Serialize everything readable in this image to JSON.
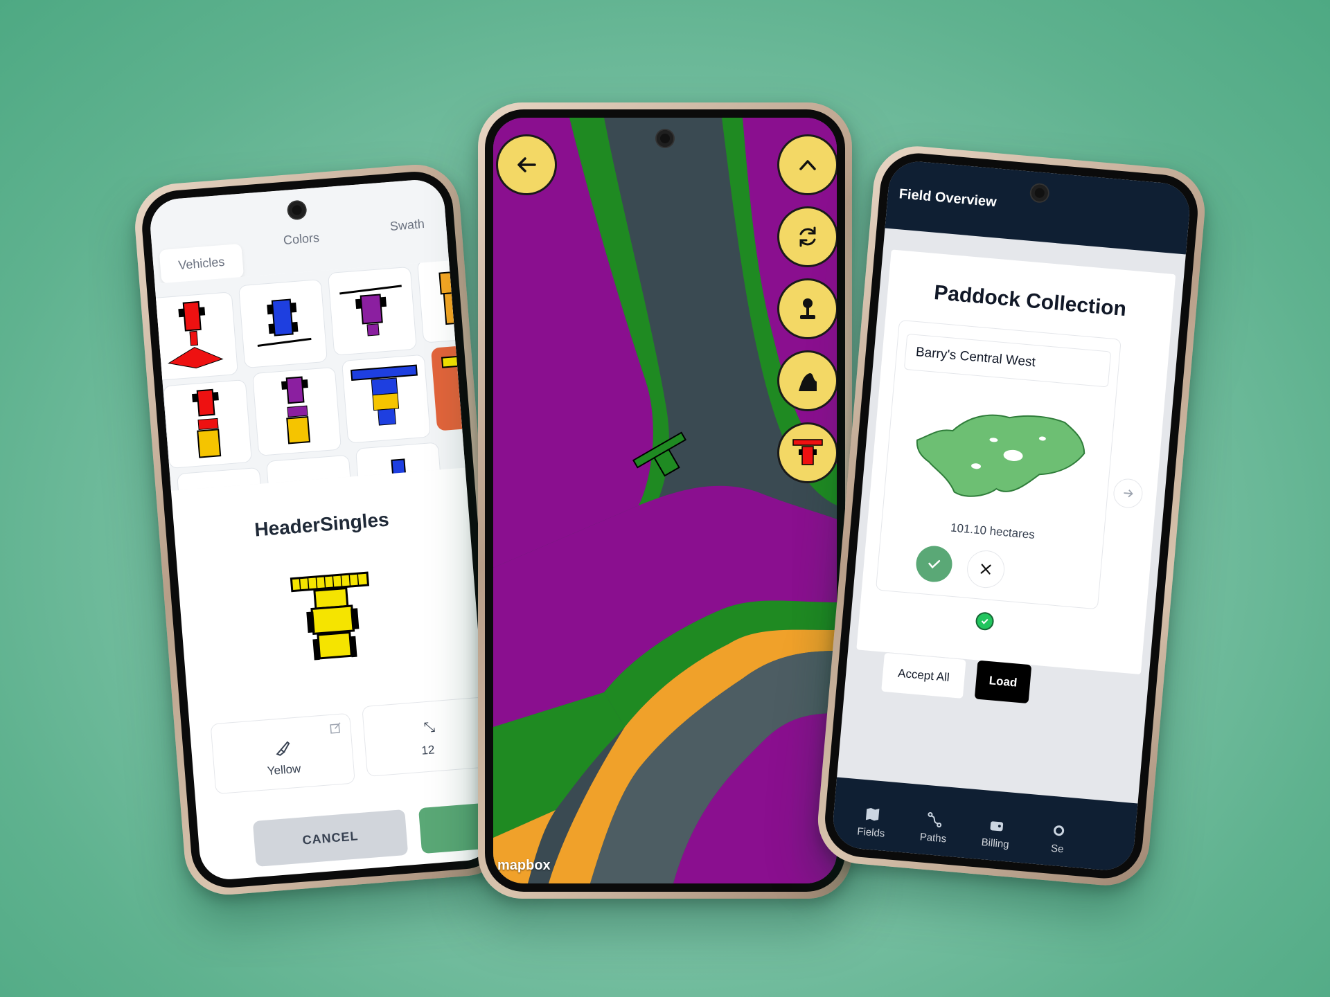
{
  "left_phone": {
    "tabs": [
      {
        "label": "Vehicles",
        "active": true
      },
      {
        "label": "Colors",
        "active": false
      },
      {
        "label": "Swath",
        "active": false
      }
    ],
    "selected_vehicle_title": "HeaderSingles",
    "color_card": {
      "label": "Yellow",
      "icon": "paintbrush-icon"
    },
    "size_card": {
      "value": "12"
    },
    "cancel_label": "CANCEL"
  },
  "middle_phone": {
    "buttons": [
      "back-arrow-icon",
      "chevron-up-icon",
      "refresh-icon",
      "joystick-icon",
      "curve-path-icon",
      "vehicle-icon"
    ],
    "map_attribution": "mapbox",
    "colors": {
      "magenta": "#8a0f8f",
      "green": "#1f8a22",
      "orange": "#f0a12a",
      "button_yellow": "#f3d865"
    }
  },
  "right_phone": {
    "header_title": "Field Overview",
    "panel_title": "Paddock Collection",
    "paddock": {
      "name": "Barry's Central West",
      "area": "101.10 hectares"
    },
    "accept_all_label": "Accept All",
    "load_label": "Load",
    "nav": [
      {
        "label": "Fields",
        "icon": "map-icon"
      },
      {
        "label": "Paths",
        "icon": "route-icon"
      },
      {
        "label": "Billing",
        "icon": "wallet-icon"
      },
      {
        "label": "Se",
        "icon": "gear-icon"
      }
    ],
    "colors": {
      "header": "#0f1f33",
      "paddock_fill": "#6dbf73",
      "accept": "#5aa876"
    }
  }
}
